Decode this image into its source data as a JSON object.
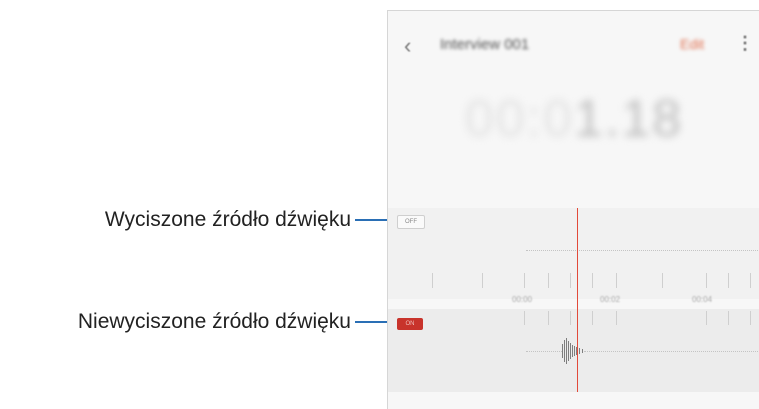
{
  "callouts": {
    "muted": "Wyciszone źródło dźwięku",
    "unmuted": "Niewyciszone źródło dźwięku"
  },
  "recorder": {
    "back_icon": "‹",
    "title": "Interview 001",
    "edit_label": "Edit",
    "more_icon": "⋮",
    "elapsed_dim": "00:0",
    "elapsed": "1.18",
    "date": "",
    "tracks": [
      {
        "tag": "OFF",
        "state": "muted"
      },
      {
        "tag": "ON",
        "state": "unmuted"
      }
    ],
    "timeline_labels": [
      "00:00",
      "00:02",
      "00:04"
    ]
  },
  "colors": {
    "accent": "#c8332b",
    "playhead": "#e24a3a",
    "callout_line": "#2a6fb5"
  }
}
